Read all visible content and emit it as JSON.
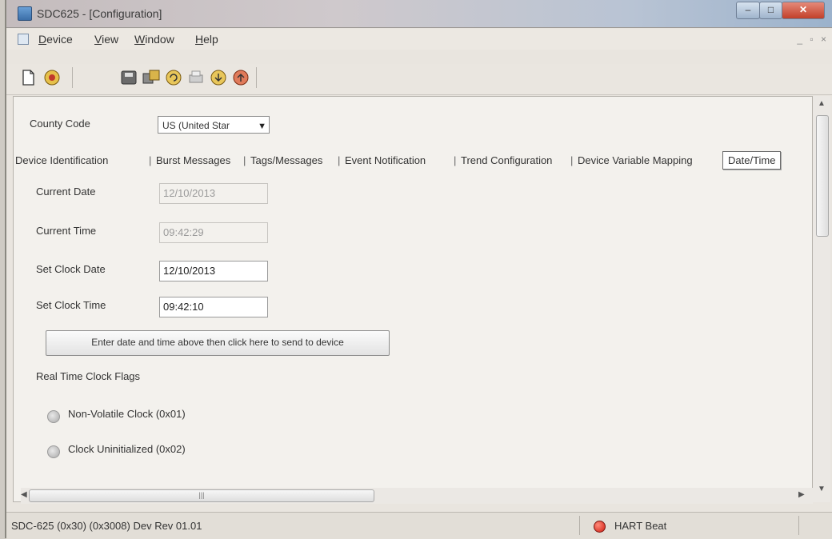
{
  "window": {
    "title": "SDC625 - [Configuration]",
    "controls": {
      "minimize": "–",
      "maximize": "□",
      "close": "✕"
    }
  },
  "menubar": {
    "items": [
      "Device",
      "View",
      "Window",
      "Help"
    ],
    "mdi_controls": "_ ▫ ×"
  },
  "toolbar": {
    "icons": [
      "new-document-icon",
      "device-icon",
      "save-icon",
      "multi-device-icon",
      "refresh-icon",
      "print-icon",
      "download-icon",
      "upload-icon"
    ]
  },
  "content": {
    "country_code_label": "County Code",
    "country_code_value": "US (United Star",
    "tabs": [
      "Device Identification",
      "Burst Messages",
      "Tags/Messages",
      "Event Notification",
      "Trend Configuration",
      "Device Variable Mapping",
      "Date/Time"
    ],
    "active_tab": "Date/Time",
    "current_date_label": "Current Date",
    "current_date_value": "12/10/2013",
    "current_time_label": "Current Time",
    "current_time_value": "09:42:29",
    "set_clock_date_label": "Set Clock Date",
    "set_clock_date_value": "12/10/2013",
    "set_clock_time_label": "Set Clock Time",
    "set_clock_time_value": "09:42:10",
    "send_button_label": "Enter date and time above then click here to send to device",
    "rtc_flags_label": "Real Time Clock Flags",
    "flags": [
      "Non-Volatile Clock (0x01)",
      "Clock Uninitialized (0x02)"
    ]
  },
  "scroll": {
    "hthumb_grip": "|||"
  },
  "statusbar": {
    "left_text": "SDC-625   (0x30)  (0x3008)  Dev Rev 01.01",
    "hart_label": "HART Beat",
    "hart_led_color": "#d01c10"
  }
}
